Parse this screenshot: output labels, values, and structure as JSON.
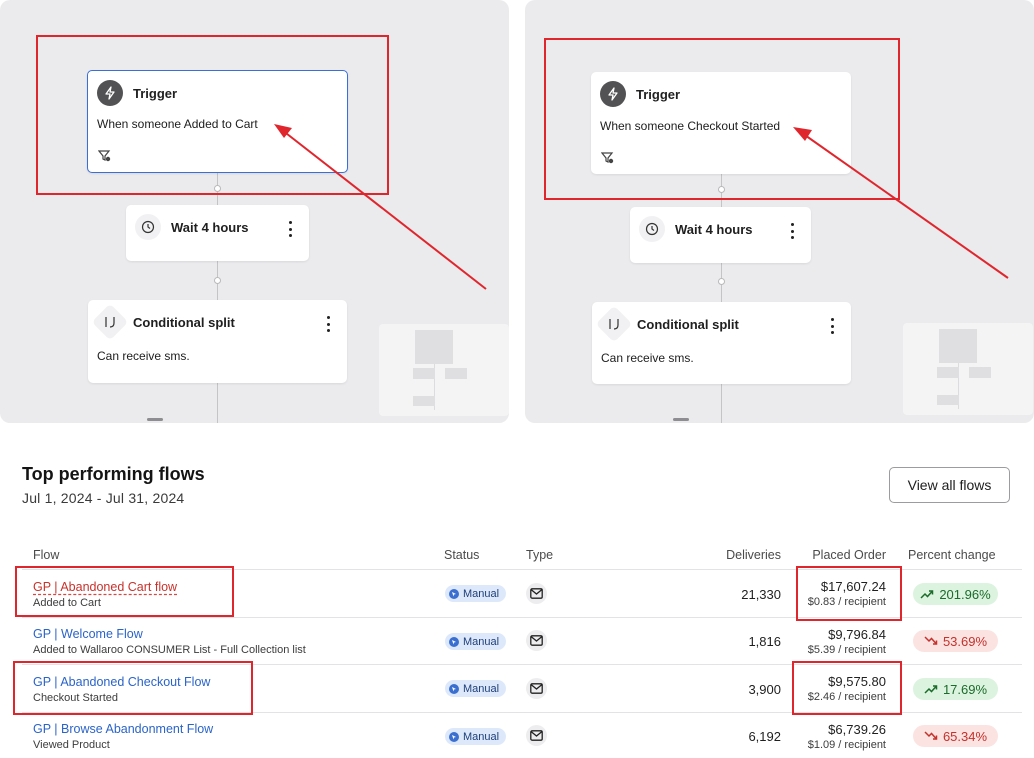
{
  "canvases": [
    {
      "trigger": {
        "title": "Trigger",
        "description": "When someone Added to Cart"
      },
      "wait": {
        "title": "Wait 4 hours"
      },
      "split": {
        "title": "Conditional split",
        "description": "Can receive sms."
      }
    },
    {
      "trigger": {
        "title": "Trigger",
        "description": "When someone Checkout Started"
      },
      "wait": {
        "title": "Wait 4 hours"
      },
      "split": {
        "title": "Conditional split",
        "description": "Can receive sms."
      }
    }
  ],
  "top_flows": {
    "title": "Top performing flows",
    "date_range": "Jul 1, 2024 - Jul 31, 2024",
    "view_all_label": "View all flows",
    "columns": {
      "flow": "Flow",
      "status": "Status",
      "type": "Type",
      "deliveries": "Deliveries",
      "placed_order": "Placed Order",
      "percent_change": "Percent change"
    },
    "rows": [
      {
        "name": "GP | Abandoned Cart flow",
        "trigger": "Added to Cart",
        "status": "Manual",
        "type_icon": "email-icon",
        "deliveries": "21,330",
        "placed_order": "$17,607.24",
        "per_recipient": "$0.83 / recipient",
        "percent_change": "201.96%",
        "trend": "up"
      },
      {
        "name": "GP | Welcome Flow",
        "trigger": "Added to Wallaroo CONSUMER List - Full Collection list",
        "status": "Manual",
        "type_icon": "email-icon",
        "deliveries": "1,816",
        "placed_order": "$9,796.84",
        "per_recipient": "$5.39 / recipient",
        "percent_change": "53.69%",
        "trend": "down"
      },
      {
        "name": "GP | Abandoned Checkout Flow",
        "trigger": "Checkout Started",
        "status": "Manual",
        "type_icon": "email-icon",
        "deliveries": "3,900",
        "placed_order": "$9,575.80",
        "per_recipient": "$2.46 / recipient",
        "percent_change": "17.69%",
        "trend": "up"
      },
      {
        "name": "GP | Browse Abandonment Flow",
        "trigger": "Viewed Product",
        "status": "Manual",
        "type_icon": "email-icon",
        "deliveries": "6,192",
        "placed_order": "$6,739.26",
        "per_recipient": "$1.09 / recipient",
        "percent_change": "65.34%",
        "trend": "down"
      }
    ]
  },
  "colors": {
    "annotation_red": "#e0262d",
    "link_blue": "#2b64c9",
    "positive_bg": "#dcf3df",
    "negative_bg": "#fbe3e2"
  }
}
